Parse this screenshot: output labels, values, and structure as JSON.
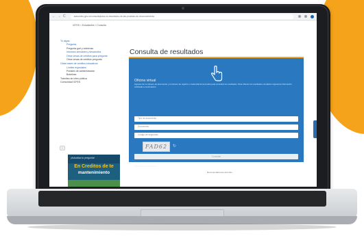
{
  "browser": {
    "back_glyph": "←",
    "forward_glyph": "→",
    "reload_glyph": "C",
    "url": "aranceles.gov.co/consulta/para-os-resultados-de-las-pruebas-de-reconocimiento"
  },
  "breadcrumb": "ICFES > Estudiantes > Consulta",
  "sidebar": {
    "items": [
      {
        "label": "Tu algoa",
        "level": 1,
        "style": "link"
      },
      {
        "label": "Pregunta",
        "level": 2,
        "style": "link"
      },
      {
        "label": "Pregunta gari y sobernas",
        "level": 2,
        "style": "text"
      },
      {
        "label": "Informes simulares y desarrollos",
        "level": 2,
        "style": "link"
      },
      {
        "label": "Otros vesas de créditos para pregunta",
        "level": 2,
        "style": "link"
      },
      {
        "label": "Otros vesas de créditos pregunta",
        "level": 2,
        "style": "text"
      },
      {
        "label": "Otras bases de créditos educativos",
        "level": 1,
        "style": "link"
      },
      {
        "label": "Límites especiales",
        "level": 2,
        "style": "link"
      },
      {
        "label": "Pórtales de administración",
        "level": 2,
        "style": "text"
      },
      {
        "label": "Boletines",
        "level": 2,
        "style": "text"
      },
      {
        "label": "Trámites de Icfes pública",
        "level": 1,
        "style": "text"
      },
      {
        "label": "Comunidad ICFES",
        "level": 1,
        "style": "text"
      }
    ]
  },
  "chat_toggle": "−",
  "banner": {
    "small_text": "¡Actualiza tu pregunta!",
    "big_text_1": "En Creditos de te",
    "big_text_2": "mantenimiento"
  },
  "main": {
    "title": "Consulta de resultados",
    "panel": {
      "section_title": "Oficina virtual",
      "intro_text": "Ingresa con tu número de documento y el número de registro o credencial de la prueba para consultar tus resultados. Para obtener los resultados completos ingresa la información solicitada a continuación.",
      "fields": [
        {
          "placeholder": "Tipo de documento"
        },
        {
          "placeholder": "Documento"
        },
        {
          "placeholder": "Código de seguridad"
        }
      ],
      "captcha_text": "FAD62",
      "captcha_refresh_glyph": "↻",
      "submit_label": "Consultar",
      "footer_link": "Términos y condiciones"
    },
    "under_text": "Recomendaciones del Icfes"
  },
  "colors": {
    "accent_orange": "#f5a31a",
    "panel_blue": "#2a78bf",
    "title_rule": "#f2a81d"
  },
  "icons": {
    "hand": "pointing-hand-icon",
    "refresh": "refresh-icon"
  }
}
